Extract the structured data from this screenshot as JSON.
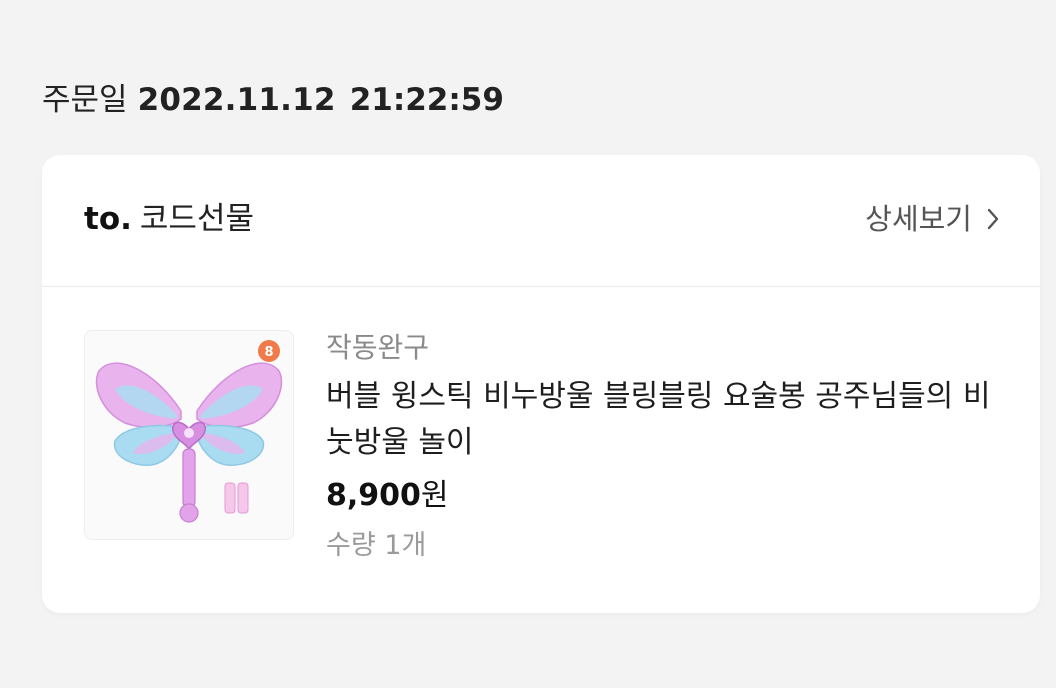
{
  "order": {
    "date_label": "주문일",
    "date": "2022.11.12",
    "time": "21:22:59"
  },
  "card": {
    "recipient_prefix": "to.",
    "recipient_name": "코드선물",
    "detail_link_label": "상세보기",
    "detail_icon": "chevron-right-icon"
  },
  "product": {
    "image_alt": "bubble wing stick toy",
    "badge_text": "8",
    "brand": "작동완구",
    "title": "버블 윙스틱 비누방울 블링블링 요술봉 공주님들의 비눗방울 놀이",
    "price_number": "8,900",
    "price_unit": "원",
    "quantity": "수량 1개"
  },
  "colors": {
    "background": "#f3f3f3",
    "card": "#ffffff",
    "muted_text": "#8a8a8a",
    "wing_pink": "#e9b3ee",
    "wing_blue": "#a9dcf1"
  }
}
